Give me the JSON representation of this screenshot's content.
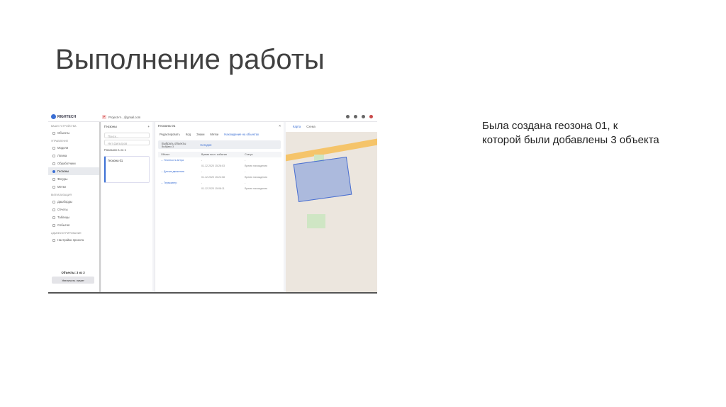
{
  "slide": {
    "title": "Выполнение работы",
    "description": "Была создана геозона 01, к которой были добавлены 3 объекта"
  },
  "app": {
    "logo": "RIGHTECH",
    "project": "Project-rt-...@gmail.com",
    "project_badge": "P"
  },
  "sidebar": {
    "sections": [
      {
        "label": "Ваши устройства",
        "items": [
          "Объекты"
        ]
      },
      {
        "label": "Управление",
        "items": [
          "Модели",
          "Логика",
          "Обработчики",
          "Геозоны",
          "Фигуры",
          "Метки"
        ]
      },
      {
        "label": "Визуализация",
        "items": [
          "Дашборды",
          "Отчеты",
          "Таблицы",
          "События"
        ]
      },
      {
        "label": "Администрирование",
        "items": [
          "Настройки проекта"
        ]
      }
    ],
    "active": "Геозоны",
    "limit_text": "Объекты: 3 из 3",
    "limit_button": "Увеличить лимит"
  },
  "list": {
    "title": "Геозоны",
    "search_placeholder": "Поиск...",
    "filter": "Нет фильтров",
    "shown": "Показано 1 из 1",
    "item": "Геозона 01"
  },
  "detail": {
    "title": "Геозона 01",
    "tabs": [
      "Редактировать",
      "Код",
      "Знаки",
      "Метки",
      "Нахождение на объектах"
    ],
    "select_label": "Выбрать объекты",
    "selected": "Выбрано 3",
    "period": "Сегодня",
    "columns": [
      "Объект",
      "Время посл. события",
      "Статус"
    ],
    "rows": [
      {
        "object": "Плотность ветра",
        "time": "01.12.2020 15:26:03",
        "status": "Время нахождения"
      },
      {
        "object": "Датчик движения",
        "time": "01.12.2020 15:24:08",
        "status": "Время нахождения"
      },
      {
        "object": "Термометр",
        "time": "01.12.2020 15:08:11",
        "status": "Время нахождения"
      }
    ]
  },
  "map": {
    "tabs": [
      "Карта",
      "Схема"
    ]
  }
}
